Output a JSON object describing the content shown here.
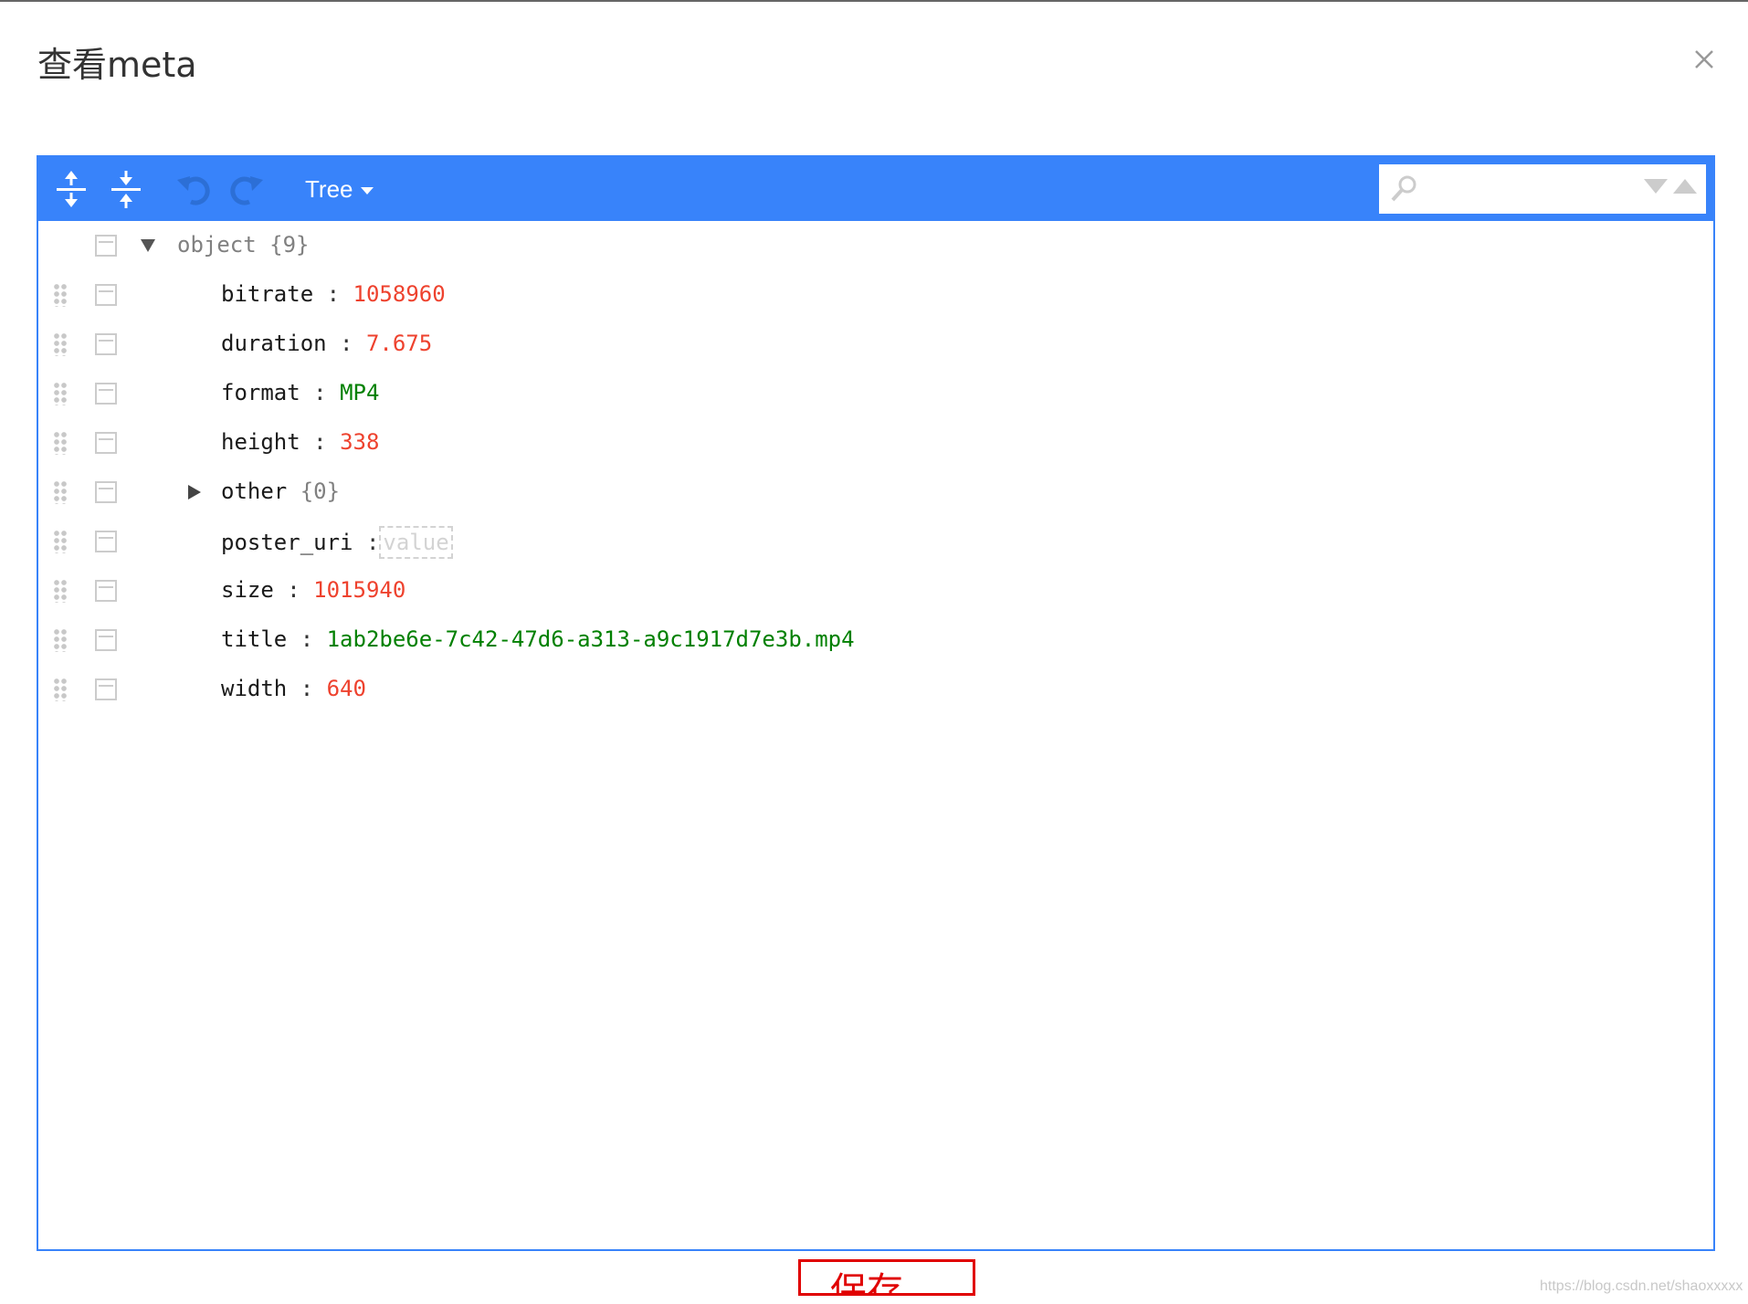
{
  "dialog": {
    "title": "查看meta"
  },
  "editor": {
    "menu": {
      "expand_all": "expand-all-icon",
      "collapse_all": "collapse-all-icon",
      "undo": "undo-icon",
      "redo": "redo-icon",
      "mode_label": "Tree",
      "accent_color": "#3883fa"
    },
    "search": {
      "value": "",
      "placeholder": ""
    },
    "root": {
      "label": "object",
      "count": "{9}"
    },
    "fields": [
      {
        "key": "bitrate",
        "value": "1058960",
        "type": "number"
      },
      {
        "key": "duration",
        "value": "7.675",
        "type": "number"
      },
      {
        "key": "format",
        "value": "MP4",
        "type": "string"
      },
      {
        "key": "height",
        "value": "338",
        "type": "number"
      },
      {
        "key": "other",
        "value": "{0}",
        "type": "object"
      },
      {
        "key": "poster_uri",
        "value": "value",
        "type": "empty"
      },
      {
        "key": "size",
        "value": "1015940",
        "type": "number"
      },
      {
        "key": "title",
        "value": "1ab2be6e-7c42-47d6-a313-a9c1917d7e3b.mp4",
        "type": "string"
      },
      {
        "key": "width",
        "value": "640",
        "type": "number"
      }
    ],
    "colors": {
      "number": "#ee422e",
      "string": "#008000",
      "object": "#808080"
    }
  },
  "footer": {
    "save_label": "保存"
  },
  "watermark": "https://blog.csdn.net/shaoxxxxx"
}
